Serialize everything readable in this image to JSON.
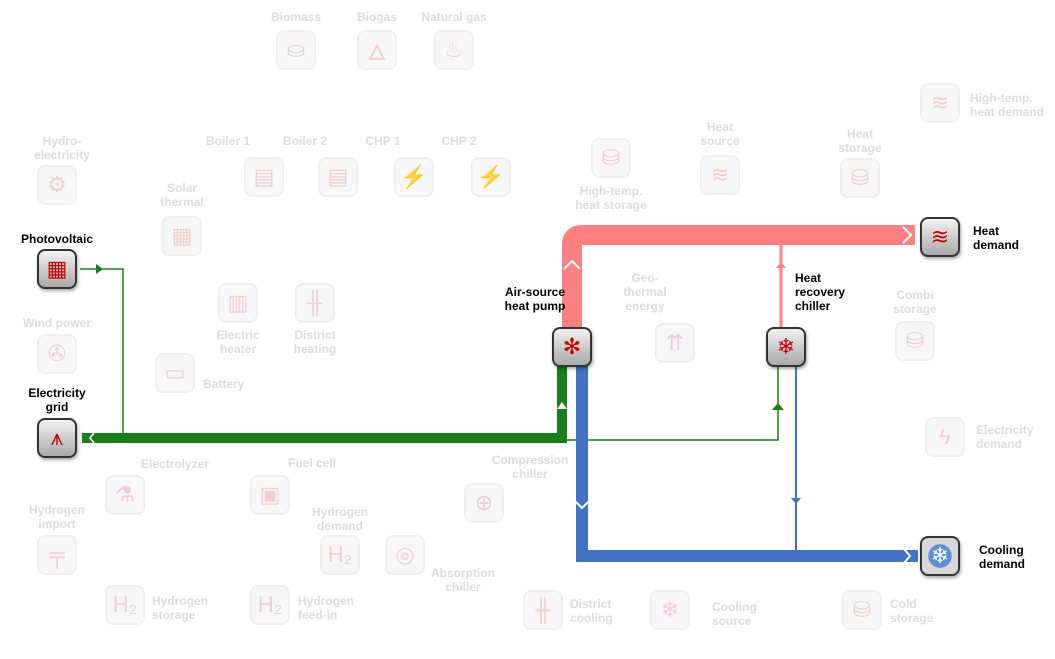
{
  "colors": {
    "heat": "#ff8080",
    "electricity": "#1a7f1a",
    "cooling": "#4472c4"
  },
  "nodes": {
    "biomass": {
      "label": "Biomass",
      "icon": "logs-icon",
      "active": false
    },
    "biogas": {
      "label": "Biogas",
      "icon": "bio-flame-icon",
      "active": false
    },
    "natural_gas": {
      "label": "Natural gas",
      "icon": "flame-icon",
      "active": false
    },
    "high_temp_heat_demand": {
      "label": "High-temp.\nheat demand",
      "icon": "heat-waves-icon",
      "active": false
    },
    "hydro": {
      "label": "Hydro-\nelectricity",
      "icon": "water-wheel-icon",
      "active": false
    },
    "boiler1": {
      "label": "Boiler 1",
      "icon": "boiler-icon",
      "active": false
    },
    "boiler2": {
      "label": "Boiler 2",
      "icon": "boiler-icon",
      "active": false
    },
    "chp1": {
      "label": "CHP 1",
      "icon": "engine-icon",
      "active": false
    },
    "chp2": {
      "label": "CHP 2",
      "icon": "engine-icon",
      "active": false
    },
    "solar_thermal": {
      "label": "Solar\nthermal",
      "icon": "solar-collector-icon",
      "active": false
    },
    "ht_storage": {
      "label": "High-temp.\nheat storage",
      "icon": "tank-icon",
      "active": false
    },
    "heat_source": {
      "label": "Heat\nsource",
      "icon": "heat-source-icon",
      "active": false
    },
    "heat_storage": {
      "label": "Heat\nstorage",
      "icon": "tank-icon",
      "active": false
    },
    "photovoltaic": {
      "label": "Photovoltaic",
      "icon": "solar-panel-icon",
      "active": true
    },
    "heat_demand": {
      "label": "Heat\ndemand",
      "icon": "heat-waves-icon",
      "active": true
    },
    "electric_heater": {
      "label": "Electric\nheater",
      "icon": "electric-heater-icon",
      "active": false
    },
    "district_heating": {
      "label": "District\nheating",
      "icon": "district-heating-icon",
      "active": false
    },
    "wind": {
      "label": "Wind power",
      "icon": "wind-turbine-icon",
      "active": false
    },
    "battery": {
      "label": "Battery",
      "icon": "battery-icon",
      "active": false
    },
    "geothermal": {
      "label": "Geo-\nthermal\nenergy",
      "icon": "geothermal-icon",
      "active": false
    },
    "combi_storage": {
      "label": "Combi\nstorage",
      "icon": "tank-icon",
      "active": false
    },
    "ashp": {
      "label": "Air-source\nheat pump",
      "icon": "heat-pump-icon",
      "active": true
    },
    "hr_chiller": {
      "label": "Heat\nrecovery\nchiller",
      "icon": "heat-recovery-chiller-icon",
      "active": true
    },
    "grid": {
      "label": "Electricity\ngrid",
      "icon": "pylon-icon",
      "active": true
    },
    "elec_demand": {
      "label": "Electricity\ndemand",
      "icon": "lightning-icon",
      "active": false
    },
    "electrolyzer": {
      "label": "Electrolyzer",
      "icon": "electrolyzer-icon",
      "active": false
    },
    "fuel_cell": {
      "label": "Fuel cell",
      "icon": "fuel-cell-icon",
      "active": false
    },
    "compression_chiller": {
      "label": "Compression\nchiller",
      "icon": "compressor-icon",
      "active": false
    },
    "h2_import": {
      "label": "Hydrogen\nimport",
      "icon": "hydrogen-pipe-icon",
      "active": false
    },
    "h2_demand": {
      "label": "Hydrogen\ndemand",
      "icon": "h2-icon",
      "active": false
    },
    "absorption_chiller": {
      "label": "Absorption\nchiller",
      "icon": "absorption-icon",
      "active": false
    },
    "cooling_demand": {
      "label": "Cooling\ndemand",
      "icon": "snowflake-icon",
      "active": true
    },
    "h2_storage": {
      "label": "Hydrogen\nstorage",
      "icon": "h2-tank-icon",
      "active": false
    },
    "h2_feedin": {
      "label": "Hydrogen\nfeed-in",
      "icon": "h2-feed-icon",
      "active": false
    },
    "district_cooling": {
      "label": "District\ncooling",
      "icon": "district-cooling-icon",
      "active": false
    },
    "cooling_source": {
      "label": "Cooling\nsource",
      "icon": "snowflake-icon",
      "active": false
    },
    "cold_storage": {
      "label": "Cold\nstorage",
      "icon": "tank-icon",
      "active": false
    }
  }
}
